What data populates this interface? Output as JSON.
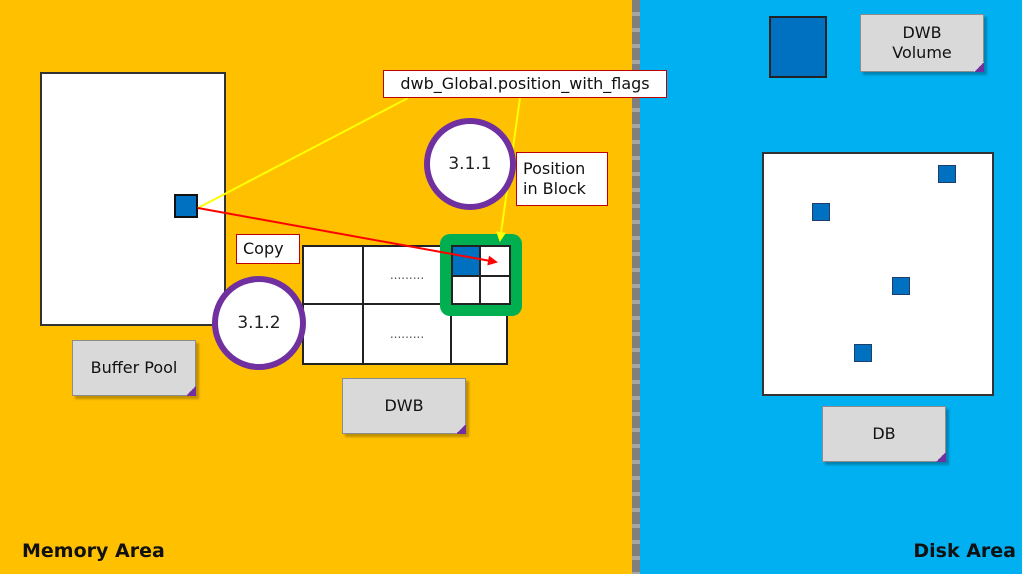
{
  "labels": {
    "position_with_flags": "dwb_Global.position_with_flags",
    "position_in_block_line1": "Position",
    "position_in_block_line2": "in Block",
    "copy": "Copy",
    "buffer_pool": "Buffer Pool",
    "dwb": "DWB",
    "dwb_volume_line1": "DWB",
    "dwb_volume_line2": "Volume",
    "db": "DB",
    "memory_area": "Memory Area",
    "disk_area": "Disk Area"
  },
  "steps": {
    "step_a": "3.1.1",
    "step_b": "3.1.2"
  },
  "dwb_grid": {
    "ellipsis_top": ".........",
    "ellipsis_bottom": "........."
  },
  "colors": {
    "memory_bg": "#FFC000",
    "disk_bg": "#00B0F0",
    "page_blue": "#0070C0",
    "arrow_red": "#FF0000",
    "arrow_yellow": "#FFFF00",
    "circle_purple": "#7030A0",
    "highlight_green": "#00B050"
  }
}
